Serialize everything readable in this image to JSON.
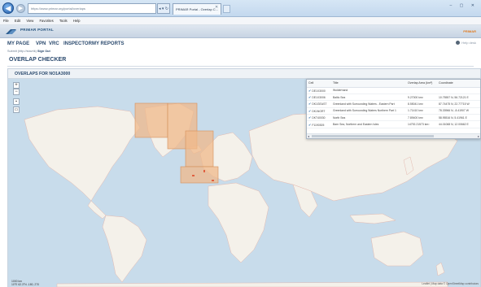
{
  "browser": {
    "address_text": "https://www.primar.org/portal/overlaps",
    "address_controls": "◂ ▾ ↻",
    "tab_title": "PRIMAR Portal - Overlap C...",
    "window_controls": "– ▢ ✕",
    "menu": [
      "File",
      "Edit",
      "View",
      "Favorites",
      "Tools",
      "Help"
    ]
  },
  "portal": {
    "title": "PRIMAR PORTAL",
    "right_text": "PRIMAR"
  },
  "nav": {
    "items": [
      "MY PAGE",
      "VPN",
      "VRC",
      "INSPECTOR",
      "MY REPORTS"
    ],
    "user_prefix": "Submit (http://stavrik)",
    "user_action": "Sign Out",
    "help": "Help desk"
  },
  "page": {
    "title": "OVERLAP CHECKER",
    "panel_title": "OVERLAPS FOR NO1A3000"
  },
  "map": {
    "zoom_in": "+",
    "zoom_out": "−",
    "tool_a": "▪",
    "tool_b": "▭",
    "scale": "1000 km",
    "coords": "10°E 62.3°N  -180, 270",
    "attribution": "Leaflet | Map data © OpenStreetMap contributors",
    "colors": {
      "sea": "#c8dceb",
      "land": "#f4f1ea",
      "overlap": "#f0b88a"
    }
  },
  "results": {
    "headers": [
      "Cell",
      "Title",
      "Overlap Area (km²)",
      "Coordinate"
    ],
    "rows": [
      [
        "DE1X3000",
        "Wolderhand",
        "",
        ""
      ],
      [
        "DE1X3006",
        "Baltic Sea",
        "9.27000 km²",
        "10.75557 N, 56.72121 E"
      ],
      [
        "DK1GEAST",
        "Greenland with Surrounding Waters - Eastern Part",
        "8.55041 km²",
        "87.74475 N, 22.77715 W"
      ],
      [
        "DK1NORT",
        "Greenland with Surrounding Waters Northern Part 1",
        "1.71410 km²",
        "78.33966 N, -8.41907 W"
      ],
      [
        "DKT40030",
        "North Sea",
        "7.89400 km²",
        "58.95516 N, 5.41961 E"
      ],
      [
        "F1190305",
        "Barn Sea, Northern and Eastern Isles",
        "14792.21573 km²",
        "44.01068 N, 12.00662 E"
      ]
    ]
  }
}
